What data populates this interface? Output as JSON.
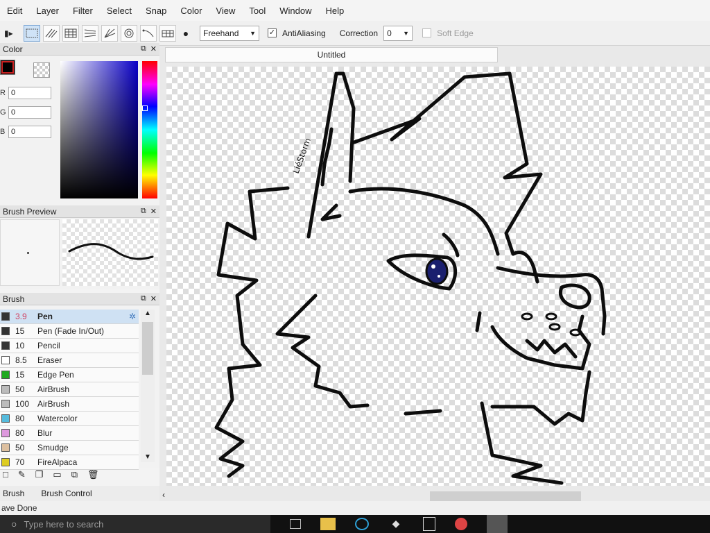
{
  "menu": [
    "Edit",
    "Layer",
    "Filter",
    "Select",
    "Snap",
    "Color",
    "View",
    "Tool",
    "Window",
    "Help"
  ],
  "toolbar": {
    "mode_value": "Freehand",
    "antialiasing_label": "AntiAliasing",
    "antialiasing_checked": true,
    "correction_label": "Correction",
    "correction_value": "0",
    "soft_edge_label": "Soft Edge"
  },
  "color_panel": {
    "title": "Color",
    "r_label": "R",
    "r_value": "0",
    "g_label": "G",
    "g_value": "0",
    "b_label": "B",
    "b_value": "0",
    "primary_color": "#000000",
    "secondary_color": "#ffffff"
  },
  "brush_preview": {
    "title": "Brush Preview"
  },
  "brush_panel": {
    "title": "Brush",
    "items": [
      {
        "size": "3.9",
        "name": "Pen",
        "color": "#333333"
      },
      {
        "size": "15",
        "name": "Pen (Fade In/Out)",
        "color": "#333333"
      },
      {
        "size": "10",
        "name": "Pencil",
        "color": "#333333"
      },
      {
        "size": "8.5",
        "name": "Eraser",
        "color": "#ffffff"
      },
      {
        "size": "15",
        "name": "Edge Pen",
        "color": "#22aa22"
      },
      {
        "size": "50",
        "name": "AirBrush",
        "color": "#bbbbbb"
      },
      {
        "size": "100",
        "name": "AirBrush",
        "color": "#bbbbbb"
      },
      {
        "size": "80",
        "name": "Watercolor",
        "color": "#55bbdd"
      },
      {
        "size": "80",
        "name": "Blur",
        "color": "#dd99dd"
      },
      {
        "size": "50",
        "name": "Smudge",
        "color": "#ddc0a0"
      },
      {
        "size": "70",
        "name": "FireAlpaca",
        "color": "#ddcc22"
      }
    ]
  },
  "bottom_tabs": [
    "Brush",
    "Brush Control"
  ],
  "document": {
    "tab_title": "Untitled",
    "signature": "LiéStorm"
  },
  "status": {
    "text": "ave Done"
  },
  "taskbar": {
    "search_placeholder": "Type here to search"
  }
}
